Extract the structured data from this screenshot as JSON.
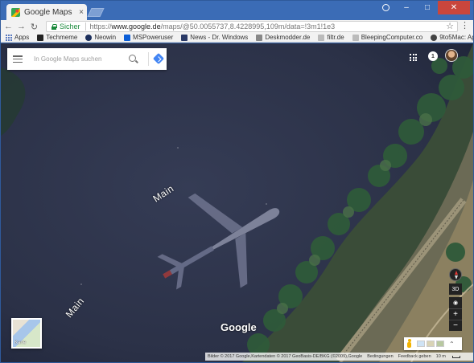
{
  "browser": {
    "tab_title": "Google Maps",
    "tab_close": "×",
    "window_controls": {
      "minimize": "–",
      "maximize": "□",
      "close": "✕"
    },
    "secure_label": "Sicher",
    "url_scheme": "https://",
    "url_host": "www.google.de",
    "url_path": "/maps/@50.0055737,8.4228995,109m/data=!3m1!1e3",
    "star": "☆",
    "menu": "⋮",
    "nav": {
      "back": "←",
      "forward": "→",
      "reload": "↻"
    }
  },
  "bookmarks": [
    {
      "label": "Apps",
      "icon": "apps-icon",
      "color": "#5a7ac0"
    },
    {
      "label": "Techmeme",
      "icon": "techmeme-icon",
      "color": "#222222"
    },
    {
      "label": "Neowin",
      "icon": "neowin-icon",
      "color": "#1c2f5c"
    },
    {
      "label": "MSPoweruser",
      "icon": "mspoweruser-icon",
      "color": "#0b5ed7"
    },
    {
      "label": "News - Dr. Windows",
      "icon": "drwindows-icon",
      "color": "#2b3a67"
    },
    {
      "label": "Deskmodder.de",
      "icon": "deskmodder-icon",
      "color": "#888888"
    },
    {
      "label": "filtr.de",
      "icon": "page-icon",
      "color": "#bbbbbb"
    },
    {
      "label": "BleepingComputer.co",
      "icon": "page-icon",
      "color": "#bbbbbb"
    },
    {
      "label": "9to5Mac: Apple iPho",
      "icon": "clock-icon",
      "color": "#444444"
    }
  ],
  "maps": {
    "search_placeholder": "In Google Maps suchen",
    "notification_label": "1",
    "river_label_1": "Main",
    "river_label_2": "Main",
    "google_logo": "Google",
    "minimap_label": "Karte",
    "controls": {
      "tilt": "3D",
      "zoom_in": "+",
      "zoom_out": "−",
      "locate": "◉"
    },
    "status": {
      "attribution": "Bilder © 2017 Google,Kartendaten © 2017 GeoBasis-DE/BKG (©2009),Google",
      "terms": "Bedingungen",
      "feedback": "Feedback geben",
      "scale": "10 m"
    },
    "expand": "⌃"
  }
}
